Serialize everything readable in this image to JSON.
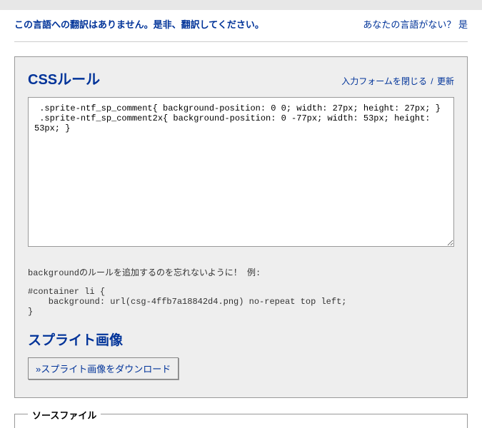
{
  "header": {
    "translation_notice": "この言語への翻訳はありません。是非、翻訳してください。",
    "language_question": "あなたの言語がない？ 是"
  },
  "panel": {
    "title": "CSSルール",
    "close_link": "入力フォームを閉じる",
    "refresh_link": "更新",
    "separator": "/",
    "css_content": " .sprite-ntf_sp_comment{ background-position: 0 0; width: 27px; height: 27px; } \n .sprite-ntf_sp_comment2x{ background-position: 0 -77px; width: 53px; height: 53px; } ",
    "hint": "backgroundのルールを追加するのを忘れないように！ 例:",
    "code_example": "#container li {\n    background: url(csg-4ffb7a18842d4.png) no-repeat top left;\n}",
    "sprite_title": "スプライト画像",
    "download_button": "»スプライト画像をダウンロード"
  },
  "fieldset": {
    "legend": "ソースファイル"
  }
}
